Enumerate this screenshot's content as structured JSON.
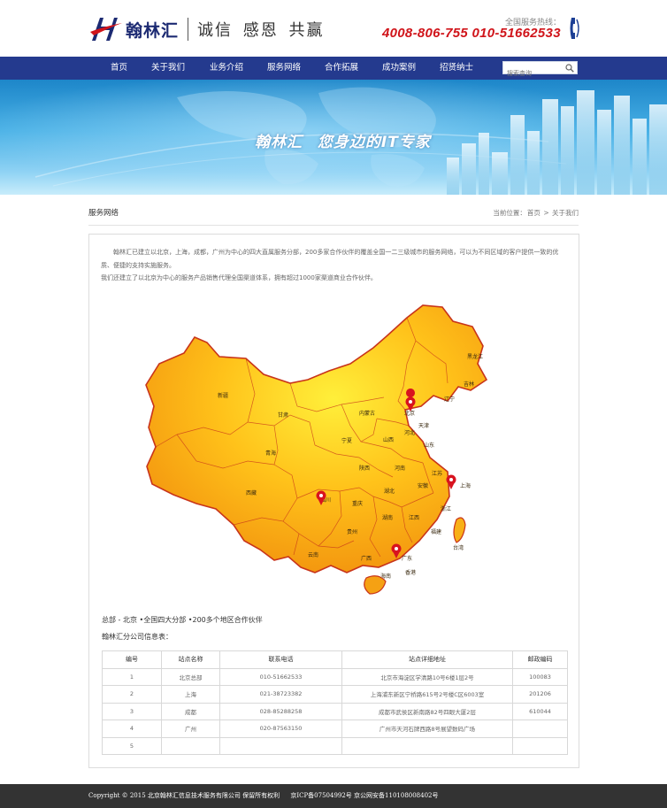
{
  "header": {
    "logo_name": "翰林汇",
    "slogan": "诚信 感恩 共赢",
    "hotline_label": "全国服务热线：",
    "hotline_numbers": "4008-806-755  010-51662533"
  },
  "nav": {
    "items": [
      {
        "label": "首页"
      },
      {
        "label": "关于我们"
      },
      {
        "label": "业务介绍"
      },
      {
        "label": "服务网络"
      },
      {
        "label": "合作拓展"
      },
      {
        "label": "成功案例"
      },
      {
        "label": "招贤纳士"
      }
    ],
    "search_placeholder": "搜索查询"
  },
  "banner": {
    "slogan": "翰林汇  您身边的IT专家"
  },
  "page": {
    "section_title": "服务网络",
    "breadcrumb_prefix": "当前位置：",
    "breadcrumb_home": "首页",
    "breadcrumb_sep": ">",
    "breadcrumb_current": "关于我们"
  },
  "content": {
    "intro_1": "翰林汇已建立以北京，上海，成都，广州为中心的四大直属服务分部，200多家合作伙伴的覆盖全国一二三级城市的服务网络，可以为不同区域的客户提供一致的优质、便捷的支持实施服务。",
    "intro_2": "我们还建立了以北京为中心的服务产品销售代理全国渠道体系，拥有超过1000家渠道商业合作伙伴。",
    "branch_line": "总部 - 北京 •全国四大分部 •200多个地区合作伙伴",
    "table_title": "翰林汇分公司信息表：",
    "map_labels": {
      "xinjiang": "新疆",
      "xizang": "西藏",
      "qinghai": "青海",
      "gansu": "甘肃",
      "neimenggu": "内蒙古",
      "heilongjiang": "黑龙江",
      "jilin": "吉林",
      "liaoning": "辽宁",
      "hebei": "河北",
      "beijing": "北京",
      "tianjin": "天津",
      "shanxi": "山西",
      "shandong": "山东",
      "ningxia": "宁夏",
      "shaanxi": "陕西",
      "henan": "河南",
      "jiangsu": "江苏",
      "shanghai": "上海",
      "anhui": "安徽",
      "hubei": "湖北",
      "sichuan": "四川",
      "chongqing": "重庆",
      "zhejiang": "浙江",
      "guizhou": "贵州",
      "hunan": "湖南",
      "jiangxi": "江西",
      "fujian": "福建",
      "taiwan": "台湾",
      "yunnan": "云南",
      "guangxi": "广西",
      "guangdong": "广东",
      "hongkong": "香港",
      "hainan": "海南"
    }
  },
  "table": {
    "headers": [
      "编号",
      "站点名称",
      "联系电话",
      "站点详细地址",
      "邮政编码"
    ],
    "rows": [
      [
        "1",
        "北京总部",
        "010-51662533",
        "北京市海淀区学清路10号6楼1层2号",
        "100083"
      ],
      [
        "2",
        "上海",
        "021-38723382",
        "上海浦东新区宁桥路615号2号楼C区6003室",
        "201206"
      ],
      [
        "3",
        "成都",
        "028-85288258",
        "成都市武侯区新南路82号四眼大厦2层",
        "610044"
      ],
      [
        "4",
        "广州",
        "020-87563150",
        "广州市天河石牌西路8号展望数码广场",
        ""
      ],
      [
        "5",
        "",
        "",
        "",
        ""
      ]
    ]
  },
  "footer": {
    "copyright": "Copyright © 2015 北京翰林汇信息技术服务有限公司 保留所有权利",
    "icp": "京ICP备07504992号",
    "police": "京公网安备110108008402号"
  },
  "colors": {
    "nav_bg": "#243a8e",
    "hotline_red": "#d0141a",
    "logo_blue": "#1c2a72",
    "pin_red": "#d8131f",
    "footer_bg": "#333333"
  }
}
